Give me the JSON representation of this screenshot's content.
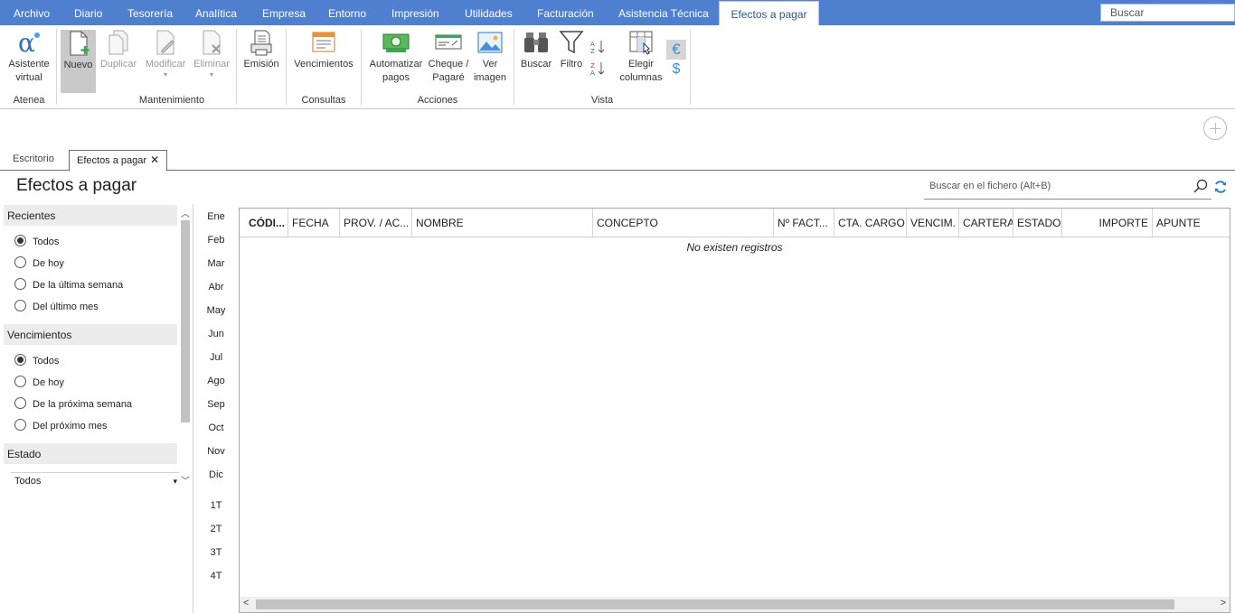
{
  "menu": {
    "items": [
      "Archivo",
      "Diario",
      "Tesorería",
      "Analítica",
      "Empresa",
      "Entorno",
      "Impresión",
      "Utilidades",
      "Facturación",
      "Asistencia Técnica"
    ],
    "active": "Efectos a pagar",
    "search_placeholder": "Buscar"
  },
  "ribbon": {
    "buttons": {
      "asistente": "Asistente virtual",
      "nuevo": "Nuevo",
      "duplicar": "Duplicar",
      "modificar": "Modificar",
      "eliminar": "Eliminar",
      "emision": "Emisión",
      "vencimientos": "Vencimientos",
      "automatizar": "Automatizar pagos",
      "cheque": "Cheque / Pagaré",
      "ver_imagen": "Ver imagen",
      "buscar": "Buscar",
      "filtro": "Filtro",
      "elegir": "Elegir columnas"
    },
    "groups": {
      "atenea": "Atenea",
      "mantenimiento": "Mantenimiento",
      "consultas": "Consultas",
      "acciones": "Acciones",
      "vista": "Vista"
    },
    "currency_symbols": [
      "€",
      "$"
    ]
  },
  "tabs": {
    "escritorio": "Escritorio",
    "efectos": "Efectos a pagar",
    "close": "✕"
  },
  "page": {
    "title": "Efectos a pagar",
    "search_placeholder": "Buscar en el fichero (Alt+B)"
  },
  "filters": {
    "recientes": {
      "title": "Recientes",
      "options": [
        "Todos",
        "De hoy",
        "De la última semana",
        "Del último mes"
      ],
      "selected": "Todos"
    },
    "vencimientos": {
      "title": "Vencimientos",
      "options": [
        "Todos",
        "De hoy",
        "De la próxima semana",
        "Del próximo mes"
      ],
      "selected": "Todos"
    },
    "estado": {
      "title": "Estado",
      "value": "Todos"
    }
  },
  "months": [
    "Ene",
    "Feb",
    "Mar",
    "Abr",
    "May",
    "Jun",
    "Jul",
    "Ago",
    "Sep",
    "Oct",
    "Nov",
    "Dic"
  ],
  "quarters": [
    "1T",
    "2T",
    "3T",
    "4T"
  ],
  "grid": {
    "columns": [
      "CÓDI...",
      "FECHA",
      "PROV. / AC...",
      "NOMBRE",
      "CONCEPTO",
      "Nº FACT...",
      "CTA. CARGO",
      "VENCIM.",
      "CARTERA",
      "ESTADO",
      "IMPORTE",
      "APUNTE"
    ],
    "empty_message": "No existen registros"
  },
  "colors": {
    "menubar": "#4f7fcf",
    "active_tab_text": "#2b5797",
    "accent_green": "#3aa655"
  }
}
